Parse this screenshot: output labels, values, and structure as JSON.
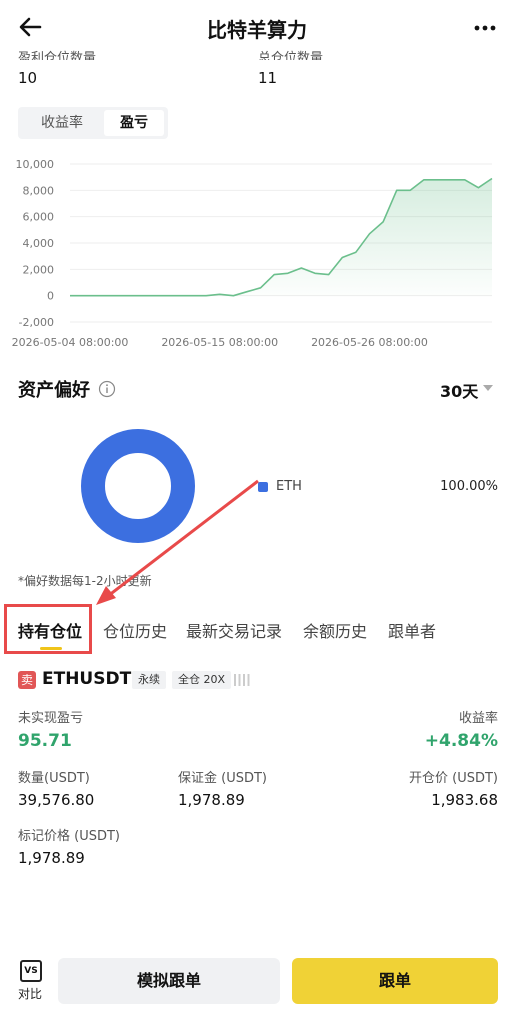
{
  "header": {
    "title": "比特羊算力"
  },
  "stats": {
    "profit_positions_label": "盈利仓位数量",
    "profit_positions_value": "10",
    "total_positions_label": "总仓位数量",
    "total_positions_value": "11"
  },
  "toggle": {
    "return_rate": "收益率",
    "pnl": "盈亏",
    "active": "盈亏"
  },
  "chart_data": {
    "type": "area",
    "title": "",
    "xlabel": "",
    "ylabel": "",
    "x_tick_labels": [
      "2026-05-04 08:00:00",
      "2026-05-15 08:00:00",
      "2026-05-26 08:00:00"
    ],
    "y_tick_labels": [
      "10,000",
      "8,000",
      "6,000",
      "4,000",
      "2,000",
      "0",
      "-2,000"
    ],
    "ylim": [
      -2000,
      10000
    ],
    "x_days_start": "2026-05-04",
    "series": [
      {
        "name": "",
        "x": [
          "2026-05-04",
          "2026-05-05",
          "2026-05-06",
          "2026-05-07",
          "2026-05-08",
          "2026-05-09",
          "2026-05-10",
          "2026-05-11",
          "2026-05-12",
          "2026-05-13",
          "2026-05-14",
          "2026-05-15",
          "2026-05-16",
          "2026-05-17",
          "2026-05-18",
          "2026-05-19",
          "2026-05-20",
          "2026-05-21",
          "2026-05-22",
          "2026-05-23",
          "2026-05-24",
          "2026-05-25",
          "2026-05-26",
          "2026-05-27",
          "2026-05-28",
          "2026-05-29",
          "2026-05-30",
          "2026-05-31",
          "2026-06-01",
          "2026-06-02",
          "2026-06-03",
          "2026-06-04"
        ],
        "values": [
          0,
          0,
          0,
          0,
          0,
          0,
          0,
          0,
          0,
          0,
          0,
          100,
          0,
          300,
          600,
          1600,
          1700,
          2100,
          1700,
          1600,
          2900,
          3300,
          4700,
          5600,
          8000,
          8000,
          8800,
          8800,
          8800,
          8800,
          8200,
          8900
        ]
      }
    ],
    "grid": true,
    "color": "#6bbf8c"
  },
  "asset_pref": {
    "title": "资产偏好",
    "period": "30天",
    "asset": "ETH",
    "asset_pct": "100.00%",
    "asset_color": "#3c6fe0",
    "note": "*偏好数据每1-2小时更新"
  },
  "tabs": [
    "持有仓位",
    "仓位历史",
    "最新交易记录",
    "余额历史",
    "跟单者"
  ],
  "position": {
    "side": "卖",
    "symbol": "ETHUSDT",
    "type_tag": "永续",
    "margin_tag": "全仓 20X",
    "unrealized_pnl_label": "未实现盈亏",
    "unrealized_pnl_value": "95.71",
    "roi_label": "收益率",
    "roi_value": "+4.84%",
    "qty_label": "数量(USDT)",
    "qty_value": "39,576.80",
    "margin_label": "保证金 (USDT)",
    "margin_value": "1,978.89",
    "entry_label": "开仓价 (USDT)",
    "entry_value": "1,983.68",
    "mark_label": "标记价格 (USDT)",
    "mark_value": "1,978.89"
  },
  "bottom": {
    "vs_icon_text": "VS",
    "vs_label": "对比",
    "simulate_button": "模拟跟单",
    "follow_button": "跟单"
  },
  "colors": {
    "accent": "#f0d236",
    "positive": "#30a46c",
    "sell": "#e15656",
    "annotation": "#e84a4a"
  }
}
